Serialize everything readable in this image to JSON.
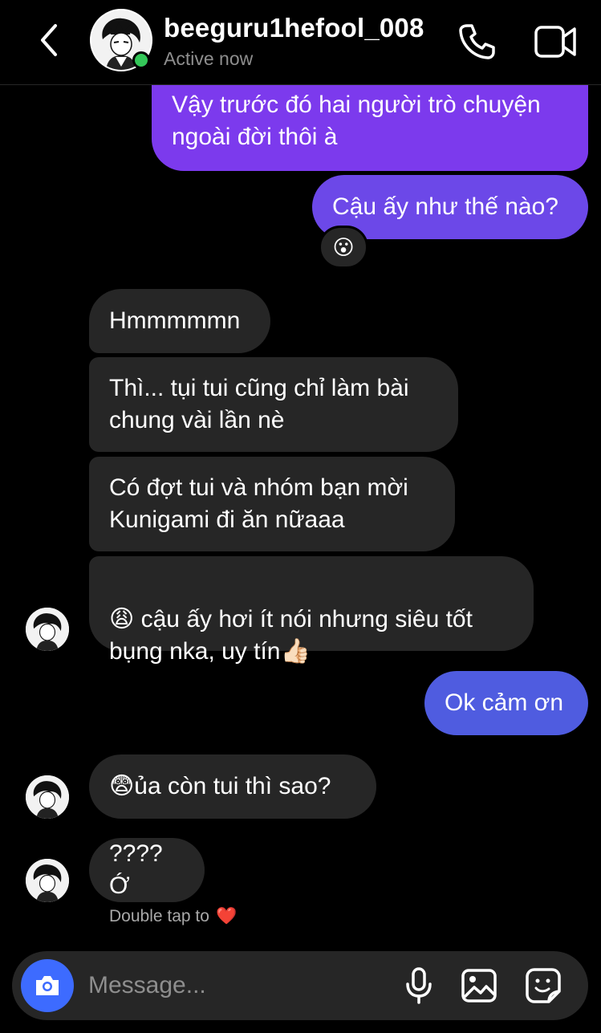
{
  "header": {
    "username": "beeguru1hefool_008",
    "status": "Active now"
  },
  "messages": [
    {
      "text": "Vậy trước đó hai người trò chuyện\nngoài đời thôi à"
    },
    {
      "text": "Cậu ấy như thế nào?"
    },
    {
      "text": "Hmmmmmn"
    },
    {
      "text": "Thì... tụi tui cũng chỉ làm bài\nchung vài lần nè"
    },
    {
      "text": "Có đợt tui và nhóm bạn mời\nKunigami đi ăn nữaaa"
    },
    {
      "emoji": "😩",
      "text": " cậu ấy hơi ít nói nhưng siêu tốt\nbụng nka, uy tín👍🏻"
    },
    {
      "text": "Ok cảm ơn"
    },
    {
      "emoji": "😨",
      "text": "ủa còn tui thì sao?"
    },
    {
      "text": "???? Ớ"
    }
  ],
  "reaction": "😮",
  "hint": {
    "text": "Double tap to",
    "emoji": "❤️"
  },
  "composer": {
    "placeholder": "Message..."
  },
  "colors": {
    "outgoing_top": "#7c3aed",
    "outgoing_mid": "#6c48e8",
    "outgoing_bottom": "#4f5ce0",
    "incoming": "#262626",
    "camera": "#3d6bff",
    "online": "#34c759"
  },
  "icons": [
    "back-chevron-icon",
    "phone-icon",
    "video-camera-icon",
    "camera-icon",
    "microphone-icon",
    "gallery-icon",
    "sticker-icon"
  ]
}
